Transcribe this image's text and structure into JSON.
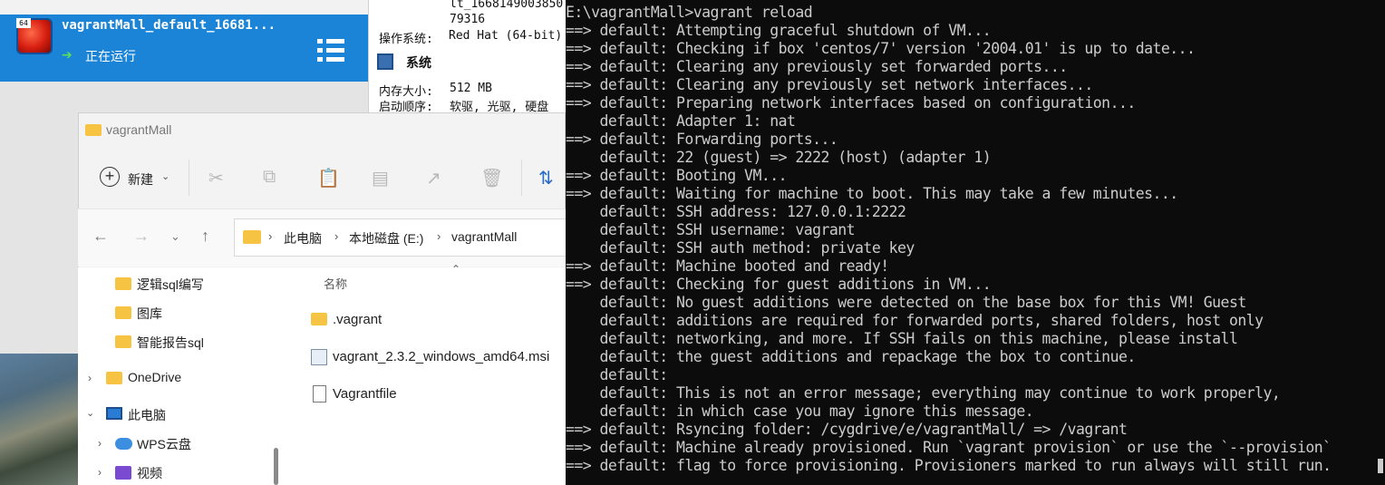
{
  "virtualbox": {
    "vm": {
      "name": "vagrantMall_default_16681...",
      "state": "正在运行",
      "os_badge": "64"
    },
    "details": {
      "id_line1": "lt_1668149003850",
      "id_line2": "79316",
      "os_label": "操作系统:",
      "os_value": "Red Hat (64-bit)",
      "system_section": "系统",
      "memory_label": "内存大小:",
      "memory_value": "512 MB",
      "boot_label": "启动顺序:",
      "boot_value": "软驱, 光驱, 硬盘"
    }
  },
  "explorer": {
    "title": "vagrantMall",
    "toolbar": {
      "new_label": "新建",
      "icons": [
        "cut-icon",
        "copy-icon",
        "paste-icon",
        "rename-icon",
        "share-icon",
        "delete-icon",
        "sort-icon"
      ]
    },
    "breadcrumb": [
      "此电脑",
      "本地磁盘 (E:)",
      "vagrantMall"
    ],
    "nav_tree": [
      {
        "label": "逻辑sql编写",
        "icon": "folder-icon",
        "expandable": false
      },
      {
        "label": "图库",
        "icon": "folder-icon",
        "expandable": false
      },
      {
        "label": "智能报告sql",
        "icon": "folder-icon",
        "expandable": false
      },
      {
        "label": "OneDrive",
        "icon": "folder-icon",
        "expandable": true,
        "expanded": false
      },
      {
        "label": "此电脑",
        "icon": "computer-icon",
        "expandable": true,
        "expanded": true
      },
      {
        "label": "WPS云盘",
        "icon": "cloud-icon",
        "expandable": true,
        "expanded": false
      },
      {
        "label": "视频",
        "icon": "video-icon",
        "expandable": true,
        "expanded": false
      }
    ],
    "column_header": "名称",
    "files": [
      {
        "name": ".vagrant",
        "icon": "folder-icon"
      },
      {
        "name": "vagrant_2.3.2_windows_amd64.msi",
        "icon": "installer-icon"
      },
      {
        "name": "Vagrantfile",
        "icon": "file-icon"
      }
    ]
  },
  "terminal": {
    "lines": [
      "E:\\vagrantMall>vagrant reload",
      "==> default: Attempting graceful shutdown of VM...",
      "==> default: Checking if box 'centos/7' version '2004.01' is up to date...",
      "==> default: Clearing any previously set forwarded ports...",
      "==> default: Clearing any previously set network interfaces...",
      "==> default: Preparing network interfaces based on configuration...",
      "    default: Adapter 1: nat",
      "==> default: Forwarding ports...",
      "    default: 22 (guest) => 2222 (host) (adapter 1)",
      "==> default: Booting VM...",
      "==> default: Waiting for machine to boot. This may take a few minutes...",
      "    default: SSH address: 127.0.0.1:2222",
      "    default: SSH username: vagrant",
      "    default: SSH auth method: private key",
      "==> default: Machine booted and ready!",
      "==> default: Checking for guest additions in VM...",
      "    default: No guest additions were detected on the base box for this VM! Guest",
      "    default: additions are required for forwarded ports, shared folders, host only",
      "    default: networking, and more. If SSH fails on this machine, please install",
      "    default: the guest additions and repackage the box to continue.",
      "    default:",
      "    default: This is not an error message; everything may continue to work properly,",
      "    default: in which case you may ignore this message.",
      "==> default: Rsyncing folder: /cygdrive/e/vagrantMall/ => /vagrant",
      "==> default: Machine already provisioned. Run `vagrant provision` or use the `--provision`",
      "==> default: flag to force provisioning. Provisioners marked to run always will still run."
    ]
  }
}
